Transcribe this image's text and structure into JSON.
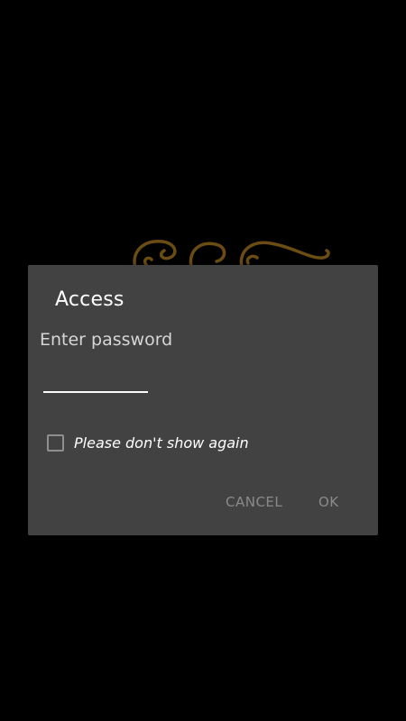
{
  "dialog": {
    "title": "Access",
    "message": "Enter password",
    "password_value": "",
    "checkbox_label": "Please don't show again",
    "checkbox_checked": false,
    "cancel_label": "CANCEL",
    "ok_label": "OK"
  },
  "colors": {
    "background": "#000000",
    "dialog_background": "#424242",
    "ornament": "#6b4d14",
    "button_text_disabled": "#8a8a8a"
  },
  "icons": {
    "ornament": "decorative-scroll-flourish"
  }
}
